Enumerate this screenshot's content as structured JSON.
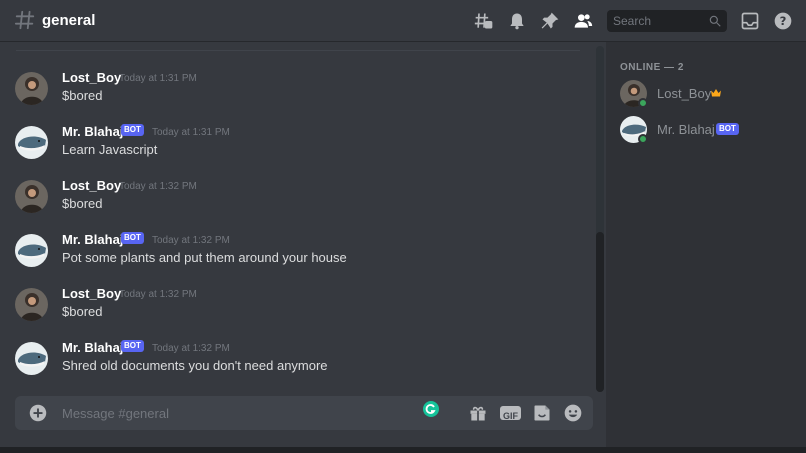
{
  "header": {
    "channel_name": "general",
    "search_placeholder": "Search"
  },
  "messages": [
    {
      "author": "Lost_Boy",
      "is_bot": false,
      "timestamp": "Today at 1:31 PM",
      "text": "$bored"
    },
    {
      "author": "Mr. Blahaj",
      "is_bot": true,
      "bot_label": "BOT",
      "timestamp": "Today at 1:31 PM",
      "text": "Learn Javascript"
    },
    {
      "author": "Lost_Boy",
      "is_bot": false,
      "timestamp": "Today at 1:32 PM",
      "text": "$bored"
    },
    {
      "author": "Mr. Blahaj",
      "is_bot": true,
      "bot_label": "BOT",
      "timestamp": "Today at 1:32 PM",
      "text": "Pot some plants and put them around your house"
    },
    {
      "author": "Lost_Boy",
      "is_bot": false,
      "timestamp": "Today at 1:32 PM",
      "text": "$bored"
    },
    {
      "author": "Mr. Blahaj",
      "is_bot": true,
      "bot_label": "BOT",
      "timestamp": "Today at 1:32 PM",
      "text": "Shred old documents you don't need anymore"
    }
  ],
  "composer": {
    "placeholder": "Message #general",
    "gif_label": "GIF"
  },
  "members": {
    "section_title": "ONLINE — 2",
    "list": [
      {
        "name": "Lost_Boy",
        "status": "online",
        "is_owner": true
      },
      {
        "name": "Mr. Blahaj",
        "status": "online",
        "is_bot": true,
        "bot_label": "BOT"
      }
    ]
  },
  "colors": {
    "background": "#36393f",
    "sidebar": "#2f3136",
    "accent_bot": "#5865f2",
    "online": "#3ba55c",
    "crown": "#faa61a"
  },
  "icons": [
    "hashtag-icon",
    "threads-icon",
    "bell-icon",
    "pin-icon",
    "members-icon",
    "search-icon",
    "inbox-icon",
    "help-icon",
    "add-icon",
    "gift-icon",
    "gif-icon",
    "sticker-icon",
    "emoji-icon",
    "grammarly-icon",
    "crown-icon"
  ]
}
